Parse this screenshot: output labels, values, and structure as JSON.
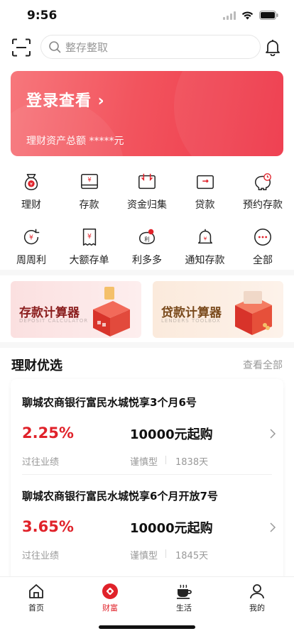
{
  "status_bar": {
    "time": "9:56"
  },
  "search": {
    "placeholder": "整存整取"
  },
  "icons": {
    "scan": "scan-icon",
    "search": "search-icon",
    "bell": "bell-icon"
  },
  "banner": {
    "title": "登录查看 ›",
    "subtitle": "理财资产总额 *****元"
  },
  "grid": [
    {
      "label": "理财",
      "icon": "wealth-bag-icon"
    },
    {
      "label": "存款",
      "icon": "deposit-icon"
    },
    {
      "label": "资金归集",
      "icon": "fund-collect-icon"
    },
    {
      "label": "贷款",
      "icon": "loan-icon"
    },
    {
      "label": "预约存款",
      "icon": "appointment-deposit-icon"
    },
    {
      "label": "周周利",
      "icon": "weekly-interest-icon"
    },
    {
      "label": "大额存单",
      "icon": "large-cd-icon"
    },
    {
      "label": "利多多",
      "icon": "piggy-bank-icon"
    },
    {
      "label": "通知存款",
      "icon": "notice-deposit-icon"
    },
    {
      "label": "全部",
      "icon": "more-icon"
    }
  ],
  "calculators": {
    "deposit": {
      "title": "存款计算器",
      "sub": "DEPOSIT CALCULATOR"
    },
    "loan": {
      "title": "贷款计算器",
      "sub": "LENDERS TOOLBOX"
    }
  },
  "section": {
    "title": "理财优选",
    "more": "查看全部"
  },
  "products": [
    {
      "name": "聊城农商银行富民水城悦享3个月6号",
      "rate": "2.25%",
      "rate_label": "过往业绩",
      "min": "10000元起购",
      "risk": "谨慎型",
      "term": "1838天"
    },
    {
      "name": "聊城农商银行富民水城悦享6个月开放7号",
      "rate": "3.65%",
      "rate_label": "过往业绩",
      "min": "10000元起购",
      "risk": "谨慎型",
      "term": "1845天"
    }
  ],
  "tabbar": [
    {
      "label": "首页",
      "icon": "home-icon",
      "active": false
    },
    {
      "label": "财富",
      "icon": "wealth-icon",
      "active": true
    },
    {
      "label": "生活",
      "icon": "coffee-icon",
      "active": false
    },
    {
      "label": "我的",
      "icon": "profile-icon",
      "active": false
    }
  ],
  "colors": {
    "brand_red": "#e0222a",
    "banner_start": "#f7777c",
    "banner_end": "#ee3648"
  }
}
